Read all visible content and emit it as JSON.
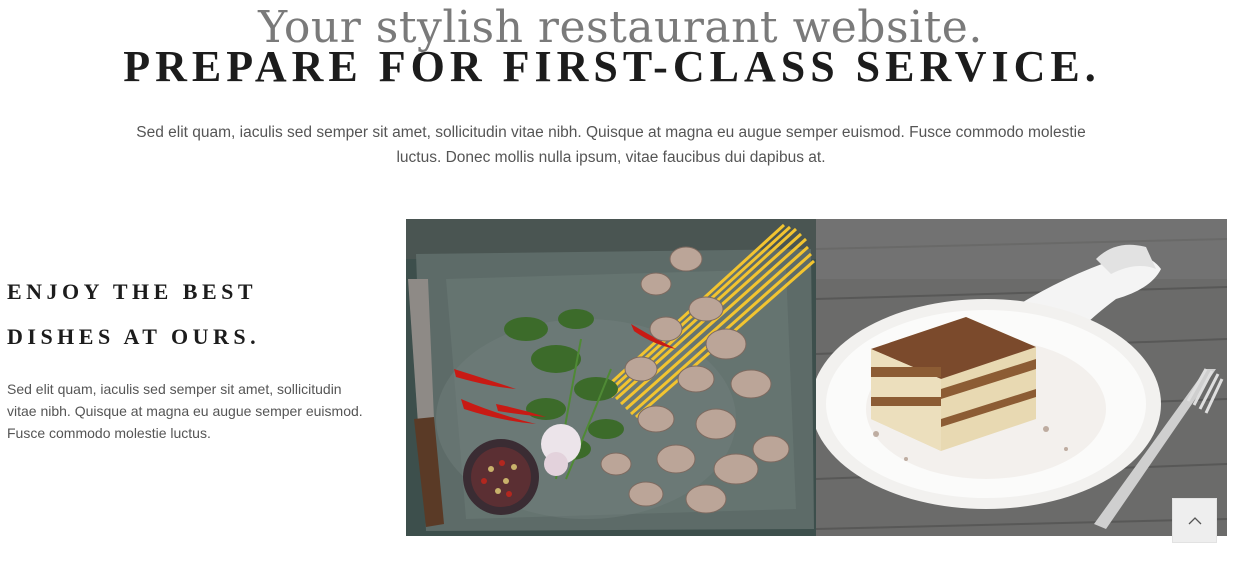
{
  "hero": {
    "tagline": "Your stylish restaurant website.",
    "headline": "PREPARE FOR FIRST-CLASS SERVICE.",
    "intro": "Sed elit quam, iaculis sed semper sit amet, sollicitudin vitae nibh. Quisque at magna eu augue semper euismod. Fusce commodo molestie luctus. Donec mollis nulla ipsum, vitae faucibus dui dapibus at."
  },
  "feature": {
    "title_line1": "ENJOY THE BEST",
    "title_line2": "DISHES AT OURS.",
    "text": "Sed elit quam, iaculis sed semper sit amet, sollicitudin vitae nibh. Quisque at magna eu augue semper euismod. Fusce commodo molestie luctus."
  },
  "gallery": {
    "images": [
      {
        "subject": "pasta-seafood-ingredients"
      },
      {
        "subject": "tiramisu-dessert"
      }
    ]
  },
  "scroll_top": {
    "icon": "chevron-up-icon"
  },
  "colors": {
    "headline": "#1c1c1c",
    "tagline": "#7a7a7a",
    "body_text": "#555555",
    "button_bg": "#eeeeee"
  }
}
